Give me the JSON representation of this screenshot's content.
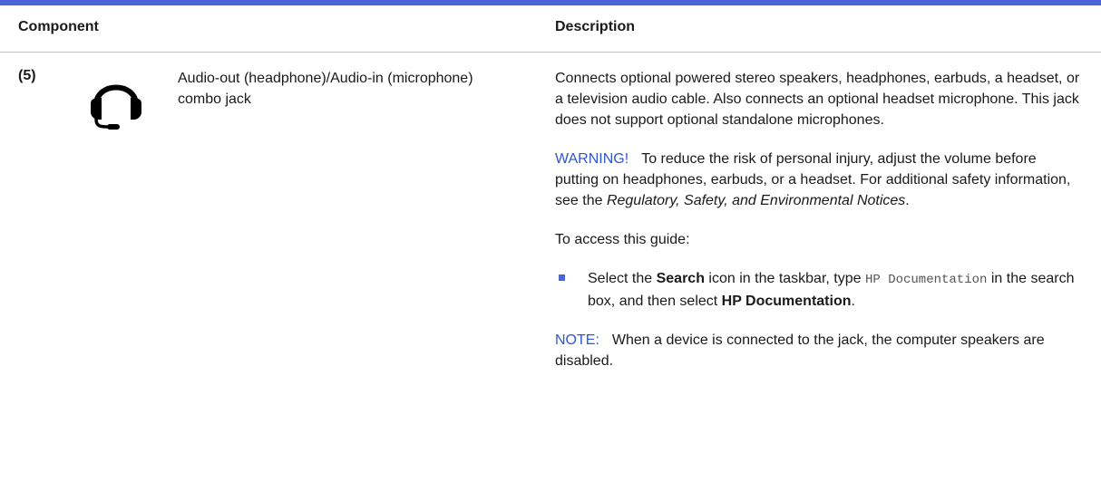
{
  "table": {
    "header": {
      "component": "Component",
      "description": "Description"
    },
    "row": {
      "number": "(5)",
      "icon": "headset-icon",
      "component_name": "Audio-out (headphone)/Audio-in (microphone) combo jack",
      "description_main": "Connects optional powered stereo speakers, headphones, earbuds, a headset, or a television audio cable. Also connects an optional headset microphone. This jack does not support optional standalone microphones.",
      "warning": {
        "label": "WARNING!",
        "text": "To reduce the risk of personal injury, adjust the volume before putting on headphones, earbuds, or a headset. For additional safety information, see the",
        "italic_ref": "Regulatory, Safety, and Environmental Notices",
        "end": "."
      },
      "access_intro": "To access this guide:",
      "bullet": {
        "t1": "Select the ",
        "b1": "Search",
        "t2": " icon in the taskbar, type ",
        "code": "HP Documentation",
        "t3": " in the search box, and then select ",
        "b2": "HP Documentation",
        "t4": "."
      },
      "note": {
        "label": "NOTE:",
        "text": "When a device is connected to the jack, the computer speakers are disabled."
      }
    },
    "colors": {
      "accent": "#4a63d6",
      "label_blue": "#2f56d9"
    }
  }
}
